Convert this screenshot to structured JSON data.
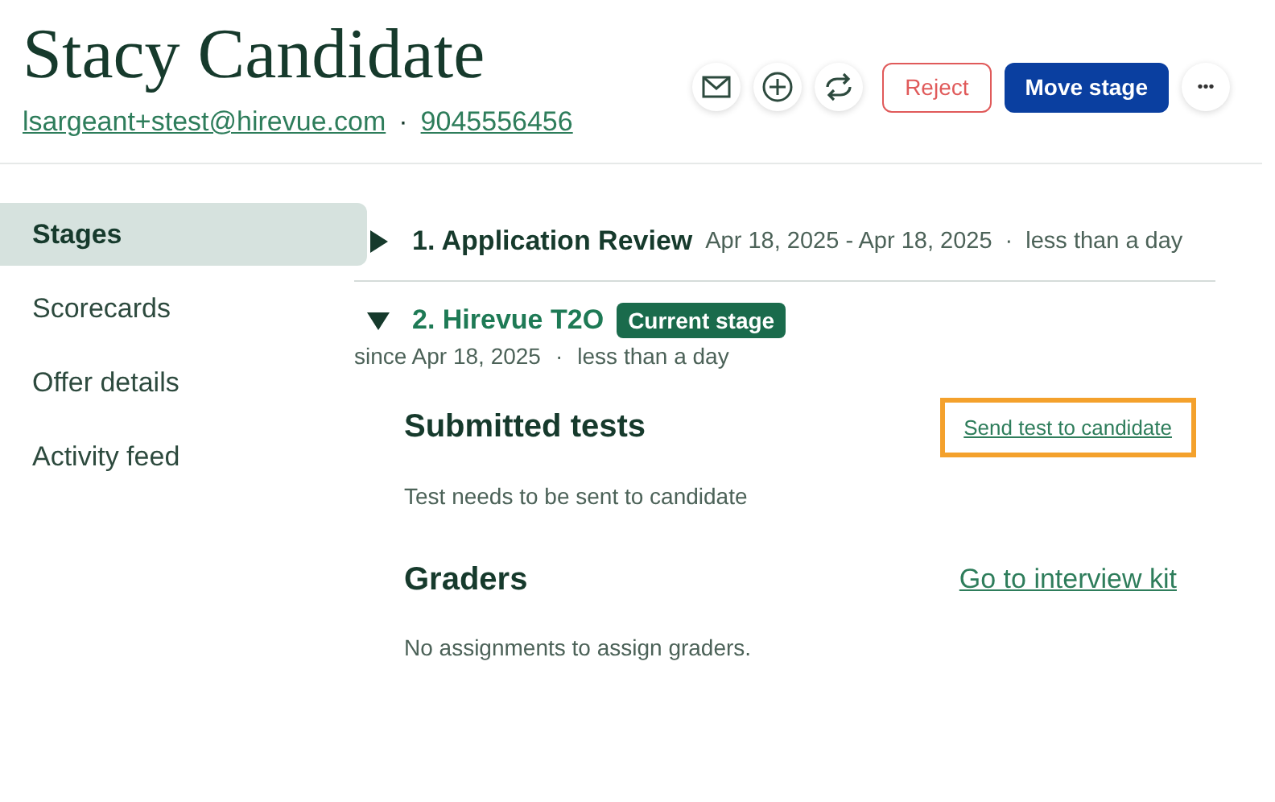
{
  "candidate": {
    "name": "Stacy Candidate",
    "email": "lsargeant+stest@hirevue.com",
    "separator": "·",
    "phone": "9045556456"
  },
  "actions": {
    "reject": "Reject",
    "move": "Move stage",
    "more": "•••"
  },
  "sidebar": {
    "items": [
      {
        "label": "Stages",
        "selected": true
      },
      {
        "label": "Scorecards",
        "selected": false
      },
      {
        "label": "Offer details",
        "selected": false
      },
      {
        "label": "Activity feed",
        "selected": false
      }
    ]
  },
  "stages": [
    {
      "title": "1. Application Review",
      "expanded": false,
      "dates": "Apr 18, 2025 - Apr 18, 2025",
      "separator": "·",
      "duration": "less than a day"
    },
    {
      "title": "2. Hirevue T2O",
      "expanded": true,
      "badge": "Current stage",
      "dates": "since Apr 18, 2025",
      "separator": "·",
      "duration": "less than a day",
      "sections": [
        {
          "title": "Submitted tests",
          "link": "Send test to candidate",
          "highlighted": true,
          "note": "Test needs to be sent to candidate"
        },
        {
          "title": "Graders",
          "link": "Go to interview kit",
          "highlighted": false,
          "note": "No assignments to assign graders."
        }
      ]
    }
  ]
}
